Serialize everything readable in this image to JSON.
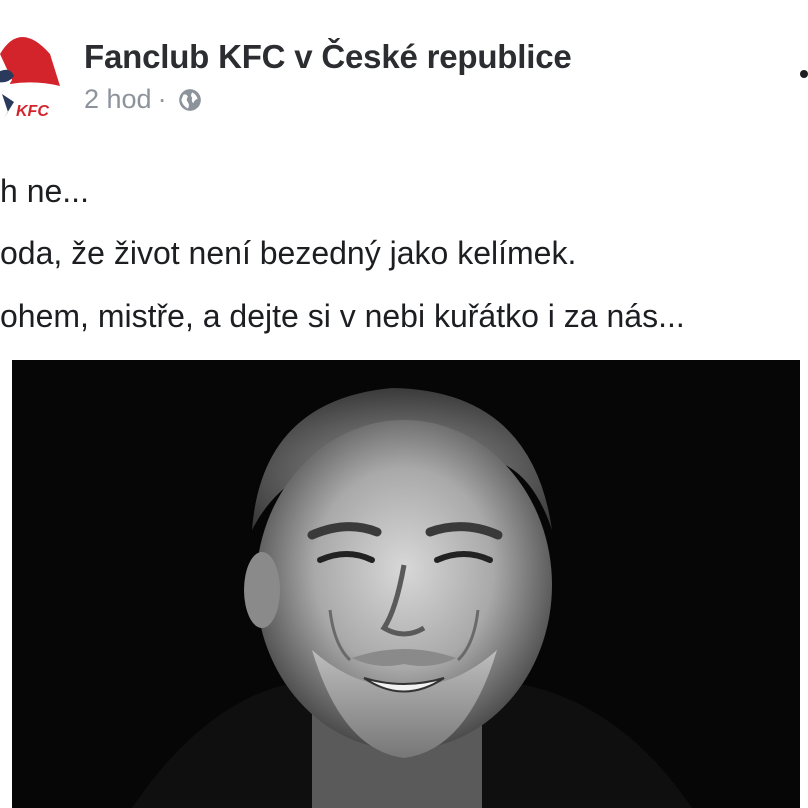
{
  "post": {
    "author": "Fanclub KFC v České republice",
    "time": "2 hod",
    "separator": "·",
    "privacy_icon": "globe-icon",
    "more_icon": "more-options-icon",
    "avatar_logo_text": "KFC",
    "lines": [
      "h ne...",
      "oda, že život není bezedný jako kelímek.",
      "ohem, mistře, a dejte si v nebi kuřátko i za nás..."
    ]
  },
  "photo": {
    "description_icon": "portrait-photo",
    "style": "black-and-white"
  },
  "colors": {
    "accent_red": "#d3242c",
    "meta_gray": "#8d939b",
    "text": "#1c1e21"
  }
}
